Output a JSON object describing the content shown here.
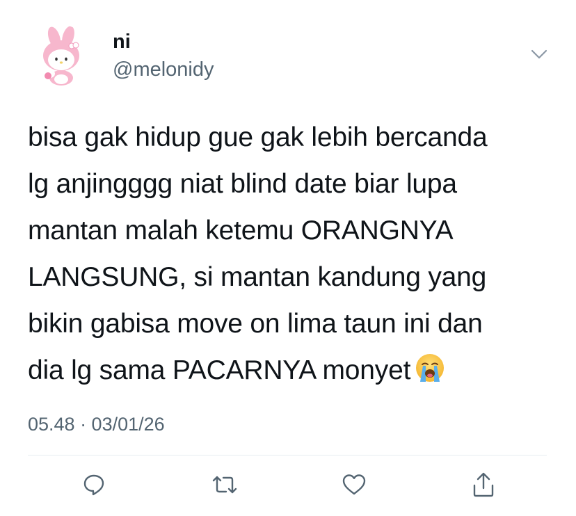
{
  "author": {
    "display_name": "ni",
    "handle": "@melonidy",
    "avatar_icon": "my-melody-avatar-icon"
  },
  "tweet": {
    "lines": [
      "bisa gak hidup gue gak lebih bercanda",
      "lg anjingggg niat blind date biar lupa",
      "mantan malah ketemu ORANGNYA",
      "LANGSUNG, si mantan kandung yang",
      "bikin gabisa move on lima taun ini dan",
      "dia lg sama PACARNYA monyet"
    ],
    "emoji": "loudly-crying-face-icon"
  },
  "timestamp": "05.48 · 03/01/26",
  "actions": {
    "reply_icon": "reply-icon",
    "retweet_icon": "retweet-icon",
    "like_icon": "heart-icon",
    "share_icon": "share-icon"
  },
  "colors": {
    "text": "#0f1419",
    "secondary": "#536471",
    "divider": "#e6ecf0",
    "avatar_pink": "#f6b6cf"
  }
}
